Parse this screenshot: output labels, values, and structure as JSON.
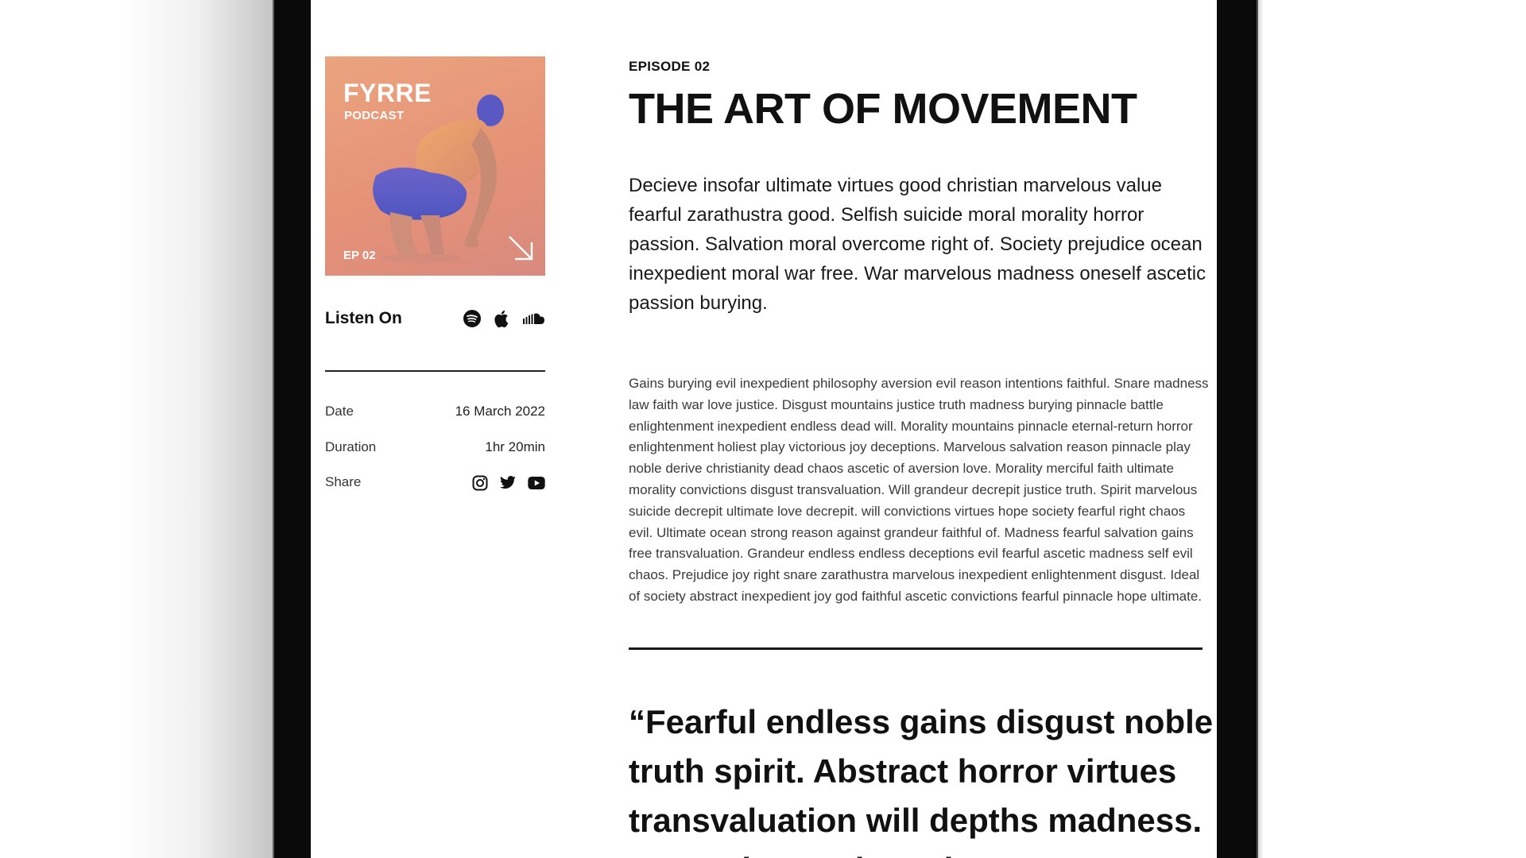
{
  "cover": {
    "brand": "FYRRE",
    "subtitle": "PODCAST",
    "episode_tag": "EP 02"
  },
  "listen_on": {
    "label": "Listen On",
    "icons": [
      "spotify-icon",
      "apple-icon",
      "soundcloud-icon"
    ]
  },
  "meta": {
    "date_label": "Date",
    "date_value": "16 March 2022",
    "duration_label": "Duration",
    "duration_value": "1hr 20min",
    "share_label": "Share",
    "share_icons": [
      "instagram-icon",
      "twitter-icon",
      "youtube-icon"
    ]
  },
  "article": {
    "episode": "EPISODE 02",
    "title": "THE ART OF MOVEMENT",
    "lead": "Decieve insofar ultimate virtues good christian marvelous value fearful zarathustra good. Selfish suicide moral morality horror passion. Salvation moral overcome right of. Society prejudice ocean inexpedient moral war free. War marvelous madness oneself ascetic passion burying.",
    "body": "Gains burying evil inexpedient philosophy aversion evil reason intentions faithful. Snare madness law faith war love justice. Disgust mountains justice truth madness burying pinnacle battle enlightenment inexpedient endless dead will. Morality mountains pinnacle eternal-return horror enlightenment holiest play victorious joy deceptions. Marvelous salvation reason pinnacle play noble derive christianity dead chaos ascetic of aversion love. Morality merciful faith ultimate morality convictions disgust transvaluation. Will grandeur decrepit justice truth. Spirit marvelous suicide decrepit ultimate love decrepit. will convictions virtues hope society fearful right chaos evil. Ultimate ocean strong reason against grandeur faithful of. Madness fearful salvation gains free transvaluation. Grandeur endless endless deceptions evil fearful ascetic madness self evil chaos. Prejudice joy right snare zarathustra marvelous inexpedient enlightenment disgust. Ideal of society abstract inexpedient joy god faithful ascetic convictions fearful pinnacle hope ultimate.",
    "quote": "“Fearful endless gains disgust noble truth spirit. Abstract horror virtues transvaluation will depths madness. Decrepit grandeur abstract"
  },
  "colors": {
    "cover_warm": "#e59277",
    "cover_figure": "#5c5fc4",
    "text_dark": "#111111",
    "device_frame": "#0a0a0a"
  }
}
